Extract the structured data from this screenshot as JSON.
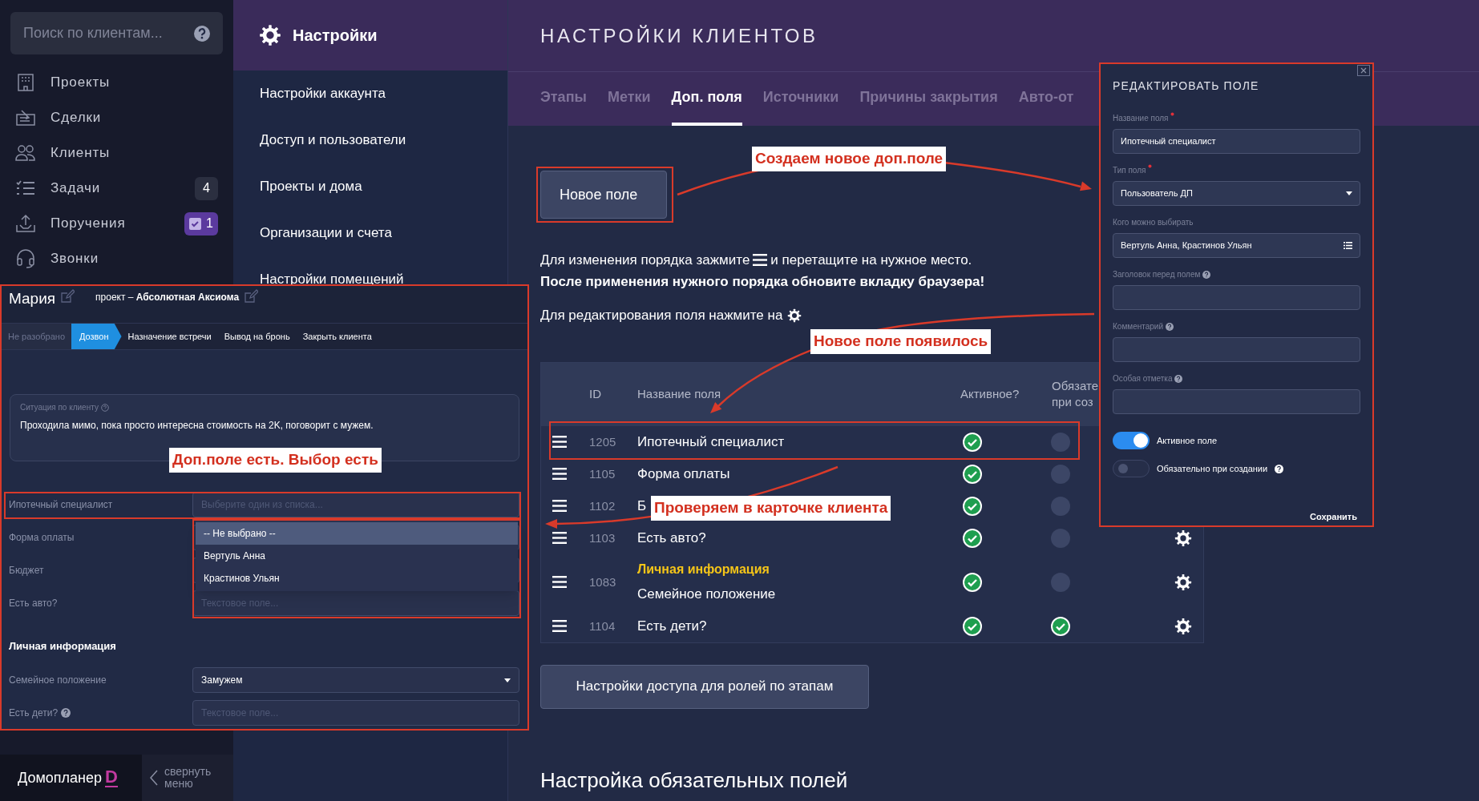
{
  "sidebar": {
    "search_placeholder": "Поиск по клиентам...",
    "nav": [
      {
        "label": "Проекты"
      },
      {
        "label": "Сделки"
      },
      {
        "label": "Клиенты"
      },
      {
        "label": "Задачи",
        "badge": "4",
        "kind": "count"
      },
      {
        "label": "Поручения",
        "badge": "1",
        "kind": "task"
      },
      {
        "label": "Звонки"
      }
    ],
    "brand": {
      "name": "Домопланер",
      "mark": "D"
    },
    "collapse": "свернуть меню"
  },
  "settings_menu": {
    "title": "Настройки",
    "items": [
      "Настройки аккаунта",
      "Доступ и пользователи",
      "Проекты и дома",
      "Организации и счета",
      "Настройки помещений"
    ]
  },
  "main": {
    "title": "НАСТРОЙКИ КЛИЕНТОВ",
    "tabs": [
      {
        "label": "Этапы",
        "selected": false
      },
      {
        "label": "Метки",
        "selected": false
      },
      {
        "label": "Доп. поля",
        "selected": true
      },
      {
        "label": "Источники",
        "selected": false
      },
      {
        "label": "Причины закрытия",
        "selected": false
      },
      {
        "label": "Авто-от",
        "selected": false
      }
    ],
    "new_field_button": "Новое поле",
    "reorder_hint": {
      "before": "Для изменения порядка зажмите",
      "after": "и перетащите на нужное место."
    },
    "refresh_hint": "После применения нужного порядка обновите вкладку браузера!",
    "edit_hint": "Для редактирования поля нажмите на",
    "table": {
      "columns": [
        {
          "lines": [
            "ID"
          ]
        },
        {
          "lines": [
            "Название поля"
          ]
        },
        {
          "lines": [
            "Активное?"
          ]
        },
        {
          "lines": [
            "Обязате",
            "при соз"
          ]
        }
      ],
      "rows": [
        {
          "id": "1205",
          "name": "Ипотечный специалист",
          "active": true,
          "required": false,
          "gear": false
        },
        {
          "id": "1105",
          "name": "Форма оплаты",
          "active": true,
          "required": false,
          "gear": false
        },
        {
          "id": "1102",
          "name": "Б",
          "active": true,
          "required": false,
          "gear": false
        },
        {
          "id": "1103",
          "name": "Есть авто?",
          "active": true,
          "required": false,
          "gear": true
        },
        {
          "id": "1083",
          "section": "Личная информация",
          "name": "Семейное положение",
          "active": true,
          "required": false,
          "gear": true
        },
        {
          "id": "1104",
          "name": "Есть дети?",
          "active": true,
          "required": true,
          "gear": true
        }
      ]
    },
    "access_button": "Настройки доступа для ролей по этапам",
    "section_heading": "Настройка обязательных полей"
  },
  "edit_panel": {
    "title": "РЕДАКТИРОВАТЬ ПОЛЕ",
    "fields": [
      {
        "label": "Название поля",
        "required": true,
        "help": false,
        "kind": "text",
        "value": "Ипотечный специалист"
      },
      {
        "label": "Тип поля",
        "required": true,
        "help": false,
        "kind": "select",
        "value": "Пользователь ДП"
      },
      {
        "label": "Кого можно выбирать",
        "required": false,
        "help": false,
        "kind": "list",
        "value": "Вертуль Анна, Крастинов Ульян"
      },
      {
        "label": "Заголовок перед полем",
        "required": false,
        "help": true,
        "kind": "text"
      },
      {
        "label": "Комментарий",
        "required": false,
        "help": true,
        "kind": "text"
      },
      {
        "label": "Особая отметка",
        "required": false,
        "help": true,
        "kind": "text"
      }
    ],
    "toggles": [
      {
        "label": "Активное поле",
        "on": true,
        "help": false
      },
      {
        "label": "Обязательно при создании",
        "on": false,
        "help": true
      }
    ],
    "save": "Сохранить"
  },
  "client_card": {
    "name": "Мария",
    "project": "проект – **Абсолютная Аксиома**",
    "stages": [
      {
        "label": "Не разобрано",
        "selected": false
      },
      {
        "label": "Дозвон",
        "selected": true
      },
      {
        "label": "Назначение встречи",
        "selected": false
      },
      {
        "label": "Вывод на бронь",
        "selected": false
      },
      {
        "label": "Закрыть клиента",
        "selected": false
      }
    ],
    "situation": {
      "label": "Ситуация по клиенту",
      "text": "Проходила мимо, пока просто интересна стоимость на 2K, поговорит с мужем."
    },
    "fields": [
      {
        "label": "Ипотечный специалист",
        "kind": "select",
        "placeholder": "Выберите один из списка..."
      },
      {
        "label": "Форма оплаты",
        "kind": "text"
      },
      {
        "label": "Бюджет",
        "kind": "text"
      },
      {
        "label": "Есть авто?",
        "kind": "text",
        "placeholder": "Текстовое поле..."
      },
      {
        "label": "Личная информация",
        "kind": "section"
      },
      {
        "label": "Семейное положение",
        "kind": "select",
        "value": "Замужем"
      },
      {
        "label": "Есть дети?",
        "kind": "text",
        "help": true,
        "placeholder": "Текстовое поле..."
      }
    ],
    "dropdown": [
      {
        "label": "-- Не выбрано --",
        "selected": true
      },
      {
        "label": "Вертуль Анна",
        "selected": false
      },
      {
        "label": "Крастинов Ульян",
        "selected": false
      }
    ]
  },
  "annotations": [
    {
      "text": "Создаем новое доп.поле"
    },
    {
      "text": "Новое поле появилось"
    },
    {
      "text": "Проверяем в карточке клиента"
    },
    {
      "text": "Доп.поле есть. Выбор есть"
    }
  ]
}
